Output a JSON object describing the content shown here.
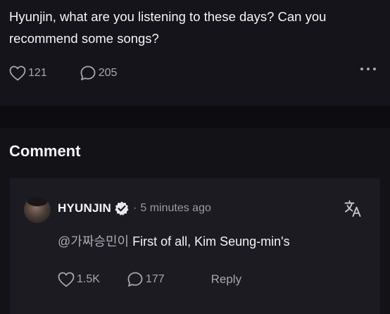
{
  "post": {
    "text": "Hyunjin, what are you listening to these days? Can you recommend some songs?",
    "like_count": "121",
    "comment_count": "205",
    "more_icon": "more-horizontal-icon"
  },
  "comments_section": {
    "title": "Comment",
    "comment": {
      "author": "HYUNJIN",
      "verified_icon": "verified-badge-icon",
      "separator": "·",
      "time": "5 minutes ago",
      "translate_icon": "translate-icon",
      "mention": "@가짜승민이",
      "text": "First of all, Kim Seung-min's",
      "like_count": "1.5K",
      "reply_count": "177",
      "reply_label": "Reply"
    }
  },
  "colors": {
    "background": "#0d0c10",
    "post_background": "#15141a",
    "card_background": "#1c1b22",
    "text_primary": "#f4f4f6",
    "text_secondary": "#a6a6ad"
  }
}
